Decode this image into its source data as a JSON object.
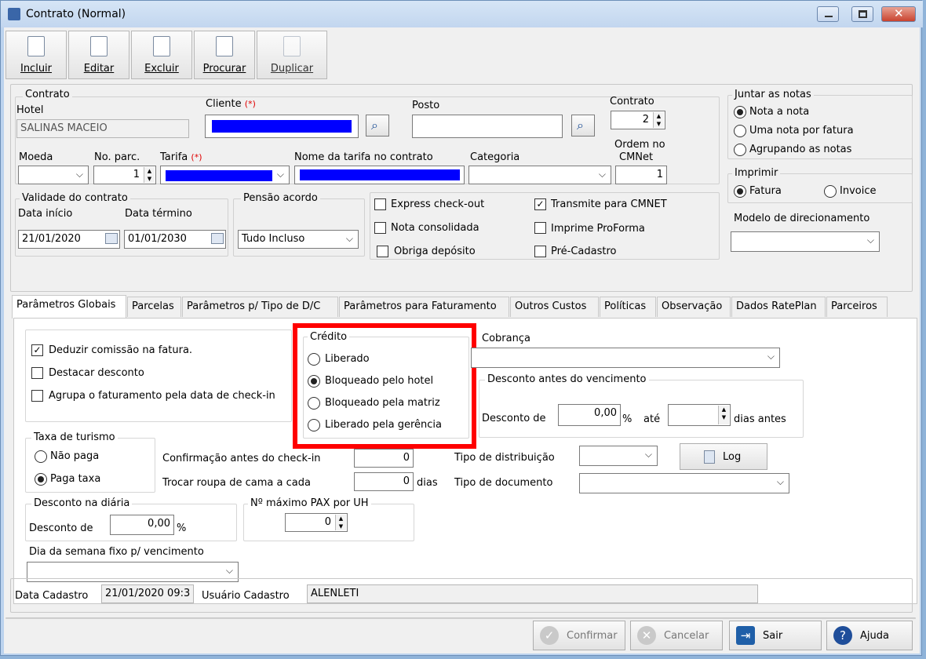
{
  "window": {
    "title": "Contrato (Normal)"
  },
  "toolbar": {
    "incluir": "Incluir",
    "editar": "Editar",
    "excluir": "Excluir",
    "procurar": "Procurar",
    "duplicar": "Duplicar"
  },
  "contrato": {
    "group_label": "Contrato",
    "hotel_label": "Hotel",
    "hotel_value": "SALINAS MACEIO",
    "cliente_label": "Cliente",
    "required_mark": "(*)",
    "posto_label": "Posto",
    "posto_value": "",
    "contrato_label": "Contrato",
    "contrato_value": "2",
    "ordem_label_1": "Ordem no",
    "ordem_label_2": "CMNet",
    "ordem_value": "1",
    "moeda_label": "Moeda",
    "moeda_value": "",
    "noparc_label": "No. parc.",
    "noparc_value": "1",
    "tarifa_label": "Tarifa",
    "nome_tarifa_label": "Nome da tarifa no contrato",
    "categoria_label": "Categoria",
    "categoria_value": ""
  },
  "juntar": {
    "label": "Juntar as notas",
    "options": [
      "Nota a nota",
      "Uma nota por fatura",
      "Agrupando as notas"
    ],
    "selected": 0
  },
  "imprimir": {
    "label": "Imprimir",
    "options": [
      "Fatura",
      "Invoice"
    ],
    "selected": 0
  },
  "modelo": {
    "label": "Modelo de direcionamento",
    "value": ""
  },
  "validade": {
    "label": "Validade do contrato",
    "inicio_label": "Data início",
    "inicio_value": "21/01/2020",
    "termino_label": "Data término",
    "termino_value": "01/01/2030"
  },
  "pensao": {
    "label": "Pensão acordo",
    "value": "Tudo Incluso"
  },
  "flags": {
    "express": "Express check-out",
    "express_checked": false,
    "nota_consolidada": "Nota consolidada",
    "nota_consolidada_checked": false,
    "obriga": "Obriga depósito",
    "obriga_checked": false,
    "transmite": "Transmite para CMNET",
    "transmite_checked": true,
    "proforma": "Imprime ProForma",
    "proforma_checked": false,
    "precadastro": "Pré-Cadastro",
    "precadastro_checked": false
  },
  "tabs": [
    "Parâmetros Globais",
    "Parcelas",
    "Parâmetros p/ Tipo de D/C",
    "Parâmetros para Faturamento",
    "Outros Custos",
    "Políticas",
    "Observação",
    "Dados RatePlan",
    "Parceiros"
  ],
  "globais": {
    "deduzir": "Deduzir comissão na fatura.",
    "deduzir_checked": true,
    "destacar": "Destacar desconto",
    "destacar_checked": false,
    "agrupa": "Agrupa o faturamento pela data de check-in",
    "agrupa_checked": false,
    "credito_label": "Crédito",
    "credito_options": [
      "Liberado",
      "Bloqueado pelo hotel",
      "Bloqueado pela matriz",
      "Liberado pela gerência"
    ],
    "credito_selected": 1,
    "cobranca_label": "Cobrança",
    "cobranca_value": "",
    "desc_venc_label": "Desconto antes do vencimento",
    "desconto_de": "Desconto de",
    "desc_venc_value": "0,00",
    "percent": "%",
    "ate": "até",
    "dias_antes": "dias antes",
    "dias_value": "",
    "taxa_label": "Taxa de turismo",
    "taxa_options": [
      "Não paga",
      "Paga taxa"
    ],
    "taxa_selected": 1,
    "confirmacao_label": "Confirmação antes do check-in",
    "confirmacao_value": "0",
    "trocar_label": "Trocar roupa de cama a cada",
    "trocar_value": "0",
    "dias": "dias",
    "tipo_dist_label": "Tipo de distribuição",
    "tipo_dist_value": "",
    "tipo_doc_label": "Tipo de documento",
    "tipo_doc_value": "",
    "log_label": "Log",
    "desconto_diaria_label": "Desconto na diária",
    "desconto_diaria_value": "0,00",
    "max_pax_label": "Nº máximo PAX por UH",
    "max_pax_value": "0",
    "dia_semana_label": "Dia da semana fixo p/ vencimento",
    "dia_semana_value": ""
  },
  "footer": {
    "data_cadastro_label": "Data Cadastro",
    "data_cadastro_value": "21/01/2020 09:3",
    "usuario_label": "Usuário Cadastro",
    "usuario_value": "ALENLETI"
  },
  "buttons": {
    "confirmar": "Confirmar",
    "cancelar": "Cancelar",
    "sair": "Sair",
    "ajuda": "Ajuda"
  },
  "colors": {
    "highlight": "#ff0000",
    "redacted": "#0000ff",
    "required": "#e00000"
  }
}
